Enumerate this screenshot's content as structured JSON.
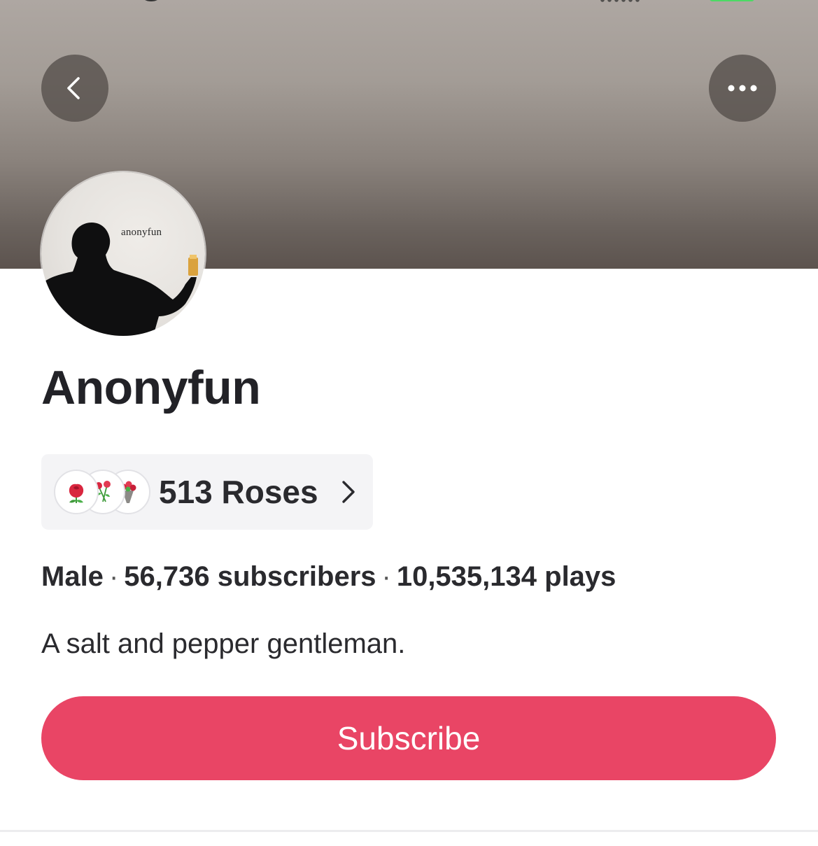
{
  "header": {
    "back_icon": "chevron-left-icon",
    "more_icon": "ellipsis-icon"
  },
  "profile": {
    "avatar_text": "anonyfun",
    "name": "Anonyfun",
    "roses": {
      "count_label": "513 Roses",
      "icons": [
        "rose-icon",
        "rose-bouquet-icon",
        "flower-bouquet-icon"
      ]
    },
    "meta": {
      "gender": "Male",
      "subscribers": "56,736 subscribers",
      "plays": "10,535,134 plays",
      "separator": "·"
    },
    "bio": "A salt and pepper gentleman."
  },
  "actions": {
    "subscribe_label": "Subscribe"
  },
  "colors": {
    "accent": "#e94565",
    "banner_top": "#aea7a2",
    "banner_bottom": "#5c534e"
  }
}
